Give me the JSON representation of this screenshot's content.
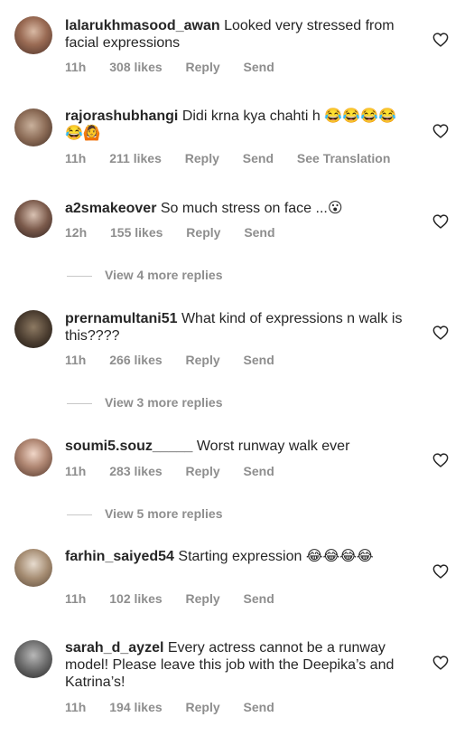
{
  "comments": [
    {
      "username": "lalarukhmasood_awan",
      "text": "Looked very stressed from facial expressions",
      "time": "11h",
      "likes": "308 likes",
      "reply": "Reply",
      "send": "Send"
    },
    {
      "username": "rajorashubhangi",
      "text": "Didi krna kya chahti h 😂😂😂😂😂🙆",
      "time": "11h",
      "likes": "211 likes",
      "reply": "Reply",
      "send": "Send",
      "translate": "See Translation"
    },
    {
      "username": "a2smakeover",
      "text": "So much stress on face ...😮",
      "time": "12h",
      "likes": "155 likes",
      "reply": "Reply",
      "send": "Send",
      "more_replies": "View 4 more replies"
    },
    {
      "username": "prernamultani51",
      "text": "What kind of expressions n walk is this????",
      "time": "11h",
      "likes": "266 likes",
      "reply": "Reply",
      "send": "Send",
      "more_replies": "View 3 more replies"
    },
    {
      "username": "soumi5.souz_____",
      "text": "Worst runway walk ever",
      "time": "11h",
      "likes": "283 likes",
      "reply": "Reply",
      "send": "Send",
      "more_replies": "View 5 more replies"
    },
    {
      "username": "farhin_saiyed54",
      "text": "Starting expression 😂😂😂😂",
      "time": "11h",
      "likes": "102 likes",
      "reply": "Reply",
      "send": "Send"
    },
    {
      "username": "sarah_d_ayzel",
      "text": "Every actress cannot be a runway model! Please leave this job with the Deepika’s and Katrina’s!",
      "time": "11h",
      "likes": "194 likes",
      "reply": "Reply",
      "send": "Send"
    }
  ],
  "icons": {
    "like": "heart-outline-icon"
  },
  "colors": {
    "meta": "#8e8e8e",
    "text": "#262626"
  }
}
